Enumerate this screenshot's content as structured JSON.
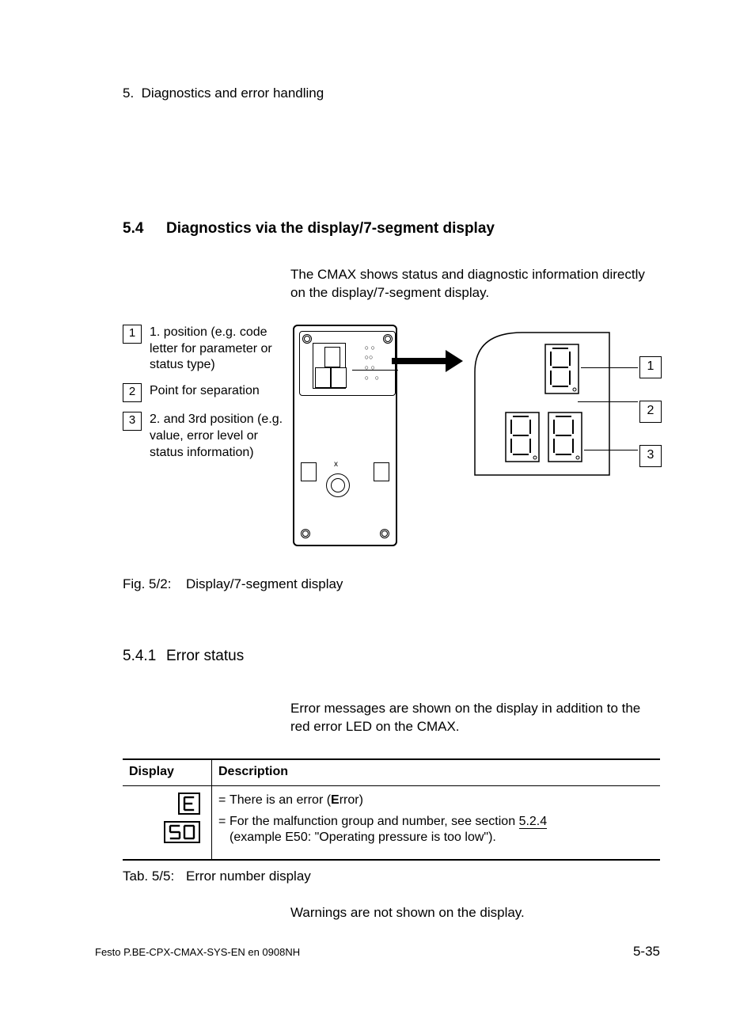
{
  "header": {
    "chapter_num": "5.",
    "chapter_title": "Diagnostics and error handling"
  },
  "section": {
    "number": "5.4",
    "title": "Diagnostics via the display/7-segment display",
    "lead": "The CMAX shows status and diagnostic information directly on the display/7-segment display."
  },
  "figure": {
    "legend": [
      {
        "num": "1",
        "text": "1. position (e.g. code letter for parameter or status type)"
      },
      {
        "num": "2",
        "text": "Point for separation"
      },
      {
        "num": "3",
        "text": "2. and 3rd position (e.g. value, error level or status information)"
      }
    ],
    "callouts": [
      "1",
      "2",
      "3"
    ],
    "caption_label": "Fig. 5/2:",
    "caption_text": "Display/7-segment display"
  },
  "subsection": {
    "number": "5.4.1",
    "title": "Error status",
    "lead": "Error messages are shown on the display in addition to the red error LED on the CMAX."
  },
  "table": {
    "headers": [
      "Display",
      "Description"
    ],
    "row": {
      "display_top": "E",
      "display_bottom": "50",
      "desc_line1_pre": "There is an error (",
      "desc_line1_bold": "E",
      "desc_line1_post": "rror)",
      "desc_line2_pre": "For the malfunction group and number, see section",
      "desc_line2_link": "5.2.4",
      "desc_line2_after": "",
      "desc_line2_sub": "(example E50: \"Operating pressure is too low\")."
    },
    "caption_label": "Tab. 5/5:",
    "caption_text": "Error number display",
    "note": "Warnings are not shown on the display."
  },
  "footer": {
    "doc_id": "Festo P.BE-CPX-CMAX-SYS-EN en 0908NH",
    "page": "5-35"
  }
}
